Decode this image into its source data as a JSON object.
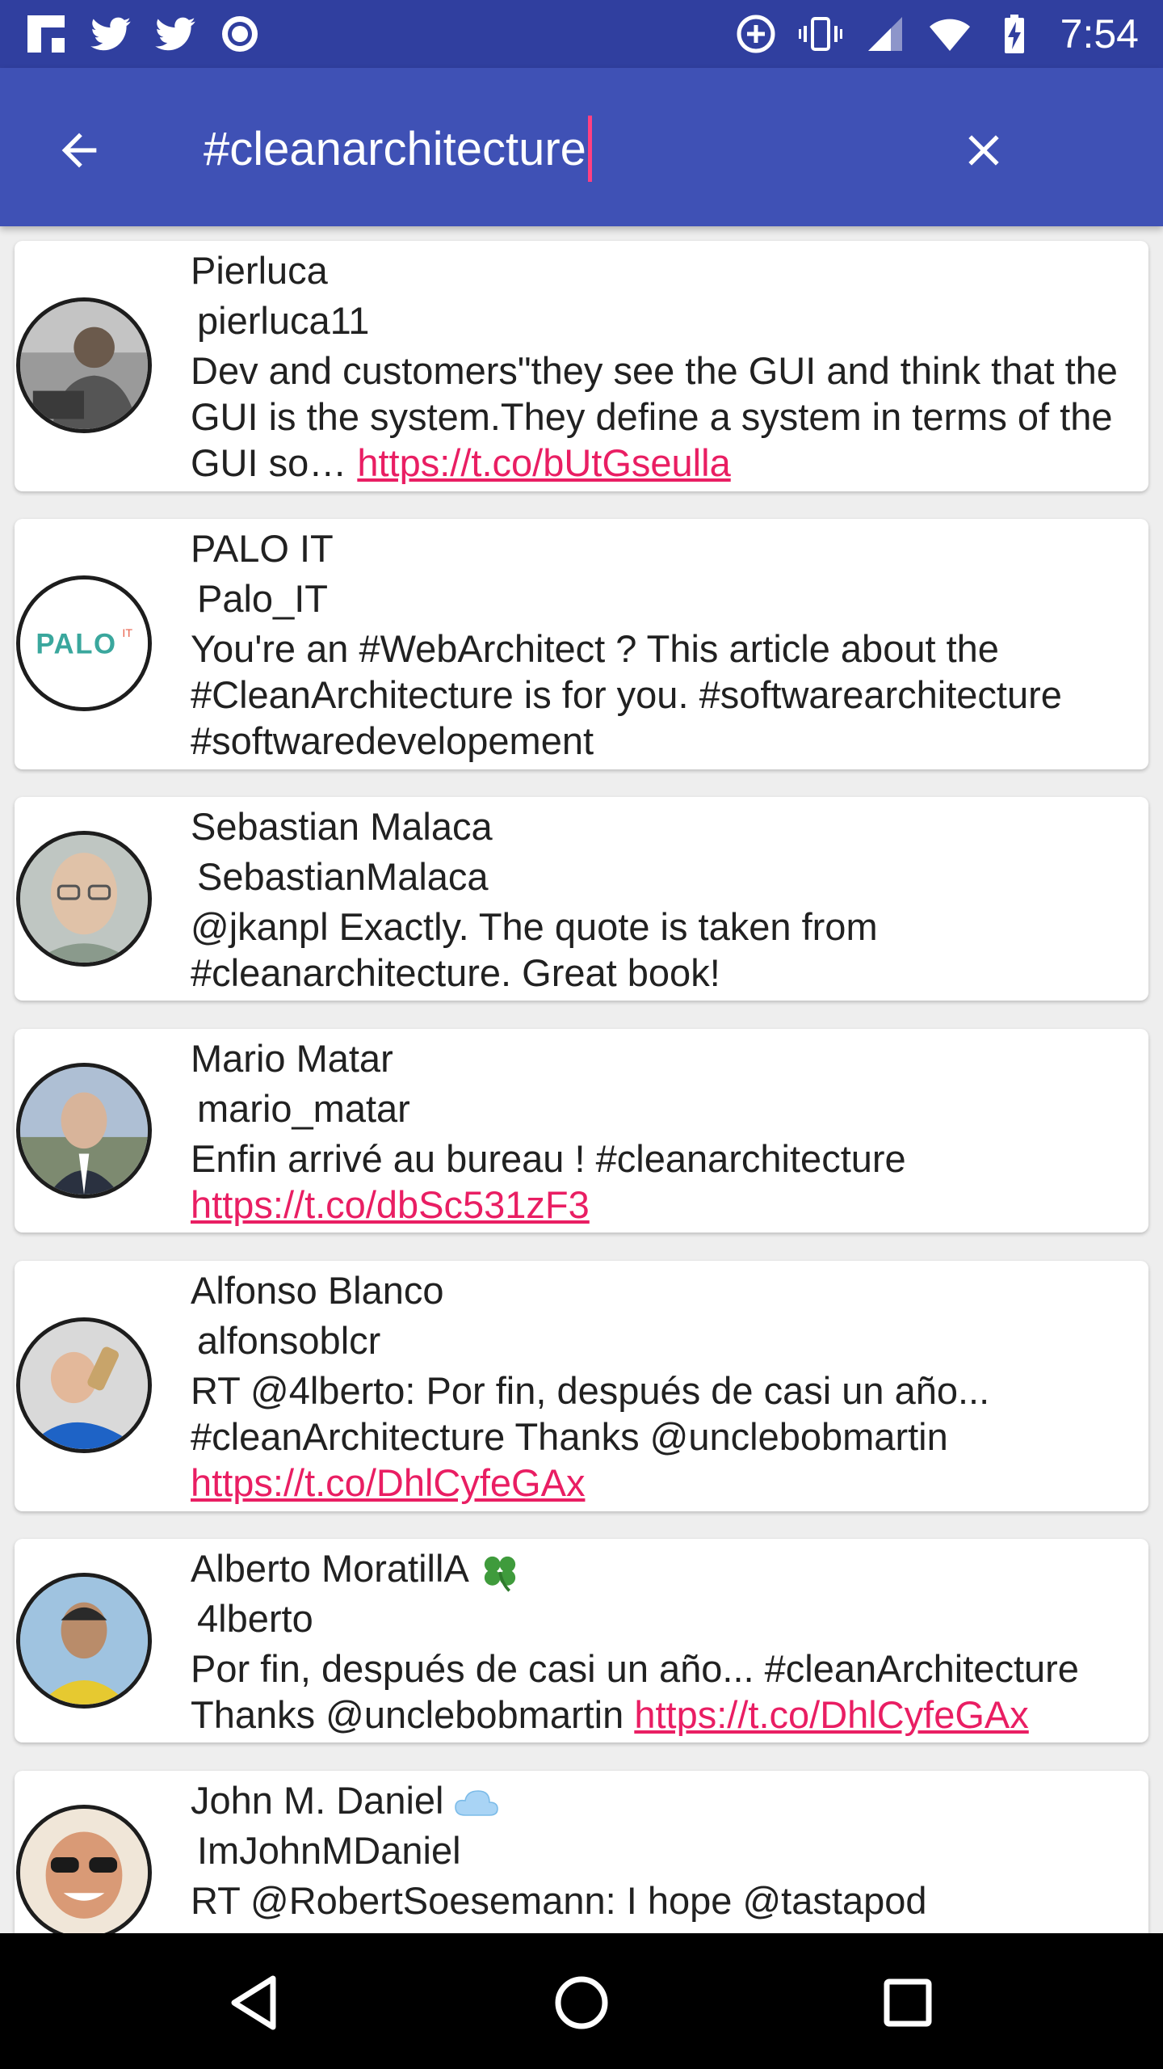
{
  "status_bar": {
    "time": "7:54",
    "icons_left": [
      "flipboard-icon",
      "twitter-icon",
      "twitter-icon",
      "circle-app-icon"
    ],
    "icons_right": [
      "data-saver-icon",
      "vibrate-icon",
      "signal-icon",
      "wifi-icon",
      "battery-charging-icon"
    ]
  },
  "toolbar": {
    "back_icon": "arrow-back-icon",
    "search_value": "#cleanarchitecture",
    "clear_icon": "close-icon"
  },
  "colors": {
    "status_bar": "#303f9f",
    "toolbar": "#3f51b5",
    "accent": "#ff4081",
    "link": "#e91e63"
  },
  "tweets": [
    {
      "name": "Pierluca",
      "handle": "pierluca11",
      "text": "Dev and customers\"they see the GUI and think that the GUI is the system.They define a system in terms of the GUI so… ",
      "link": "https://t.co/bUtGseulla",
      "avatar": "avatar-photo-man-laptop"
    },
    {
      "name": "PALO IT",
      "handle": "Palo_IT",
      "text": "You're an #WebArchitect ? This article about the #CleanArchitecture is for you. #softwarearchitecture #softwaredevelopement",
      "link": "",
      "avatar": "avatar-logo-palo-it",
      "avatar_logo_text": "PALO",
      "avatar_logo_superscript": "IT"
    },
    {
      "name": "Sebastian Malaca",
      "handle": "SebastianMalaca",
      "text": "@jkanpl Exactly. The quote is taken from #cleanarchitecture. Great book!",
      "link": "",
      "avatar": "avatar-photo-man-glasses"
    },
    {
      "name": "Mario Matar",
      "handle": "mario_matar",
      "text": "Enfin arrivé au bureau ! #cleanarchitecture ",
      "link": "https://t.co/dbSc531zF3",
      "avatar": "avatar-photo-man-suit"
    },
    {
      "name": "Alfonso Blanco",
      "handle": "alfonsoblcr",
      "text": "RT @4lberto: Por fin, después de casi un año... #cleanArchitecture Thanks @unclebobmartin ",
      "link": "https://t.co/DhlCyfeGAx",
      "avatar": "avatar-photo-man-drinking"
    },
    {
      "name": "Alberto MoratillA",
      "name_emoji": "four-leaf-clover-icon",
      "handle": "4lberto",
      "text": "Por fin, después de casi un año... #cleanArchitecture Thanks @unclebobmartin ",
      "link": "https://t.co/DhlCyfeGAx",
      "avatar": "avatar-photo-man-yellow"
    },
    {
      "name": "John M. Daniel",
      "name_emoji": "cloud-icon",
      "handle": "ImJohnMDaniel",
      "text": "RT @RobertSoesemann: I hope @tastapod",
      "link": "",
      "avatar": "avatar-photo-man-sunglasses"
    }
  ],
  "nav_bar": {
    "back_icon": "nav-back-icon",
    "home_icon": "nav-home-icon",
    "recents_icon": "nav-recents-icon"
  }
}
